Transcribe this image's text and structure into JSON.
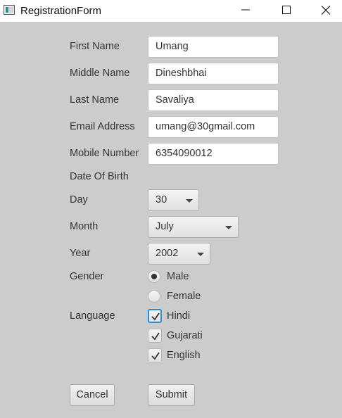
{
  "window": {
    "title": "RegistrationForm"
  },
  "form": {
    "first_name": {
      "label": "First Name",
      "value": "Umang"
    },
    "middle_name": {
      "label": "Middle Name",
      "value": "Dineshbhai"
    },
    "last_name": {
      "label": "Last Name",
      "value": "Savaliya"
    },
    "email": {
      "label": "Email Address",
      "value": "umang@30gmail.com"
    },
    "mobile": {
      "label": "Mobile Number",
      "value": "6354090012"
    },
    "dob_label": "Date Of Birth",
    "day": {
      "label": "Day",
      "value": "30"
    },
    "month": {
      "label": "Month",
      "value": "July"
    },
    "year": {
      "label": "Year",
      "value": "2002"
    },
    "gender": {
      "label": "Gender",
      "options": [
        "Male",
        "Female"
      ],
      "selected": "Male"
    },
    "language": {
      "label": "Language",
      "options": [
        "Hindi",
        "Gujarati",
        "English"
      ],
      "checked": [
        "Hindi",
        "Gujarati",
        "English"
      ]
    },
    "buttons": {
      "cancel": "Cancel",
      "submit": "Submit"
    }
  },
  "colors": {
    "background": "#cccccc",
    "focus": "#2b8dd6",
    "titlebar": "#ffffff"
  },
  "icons": [
    "app-icon",
    "minimize-icon",
    "maximize-icon",
    "close-icon",
    "chevron-down-icon",
    "checkmark-icon"
  ]
}
